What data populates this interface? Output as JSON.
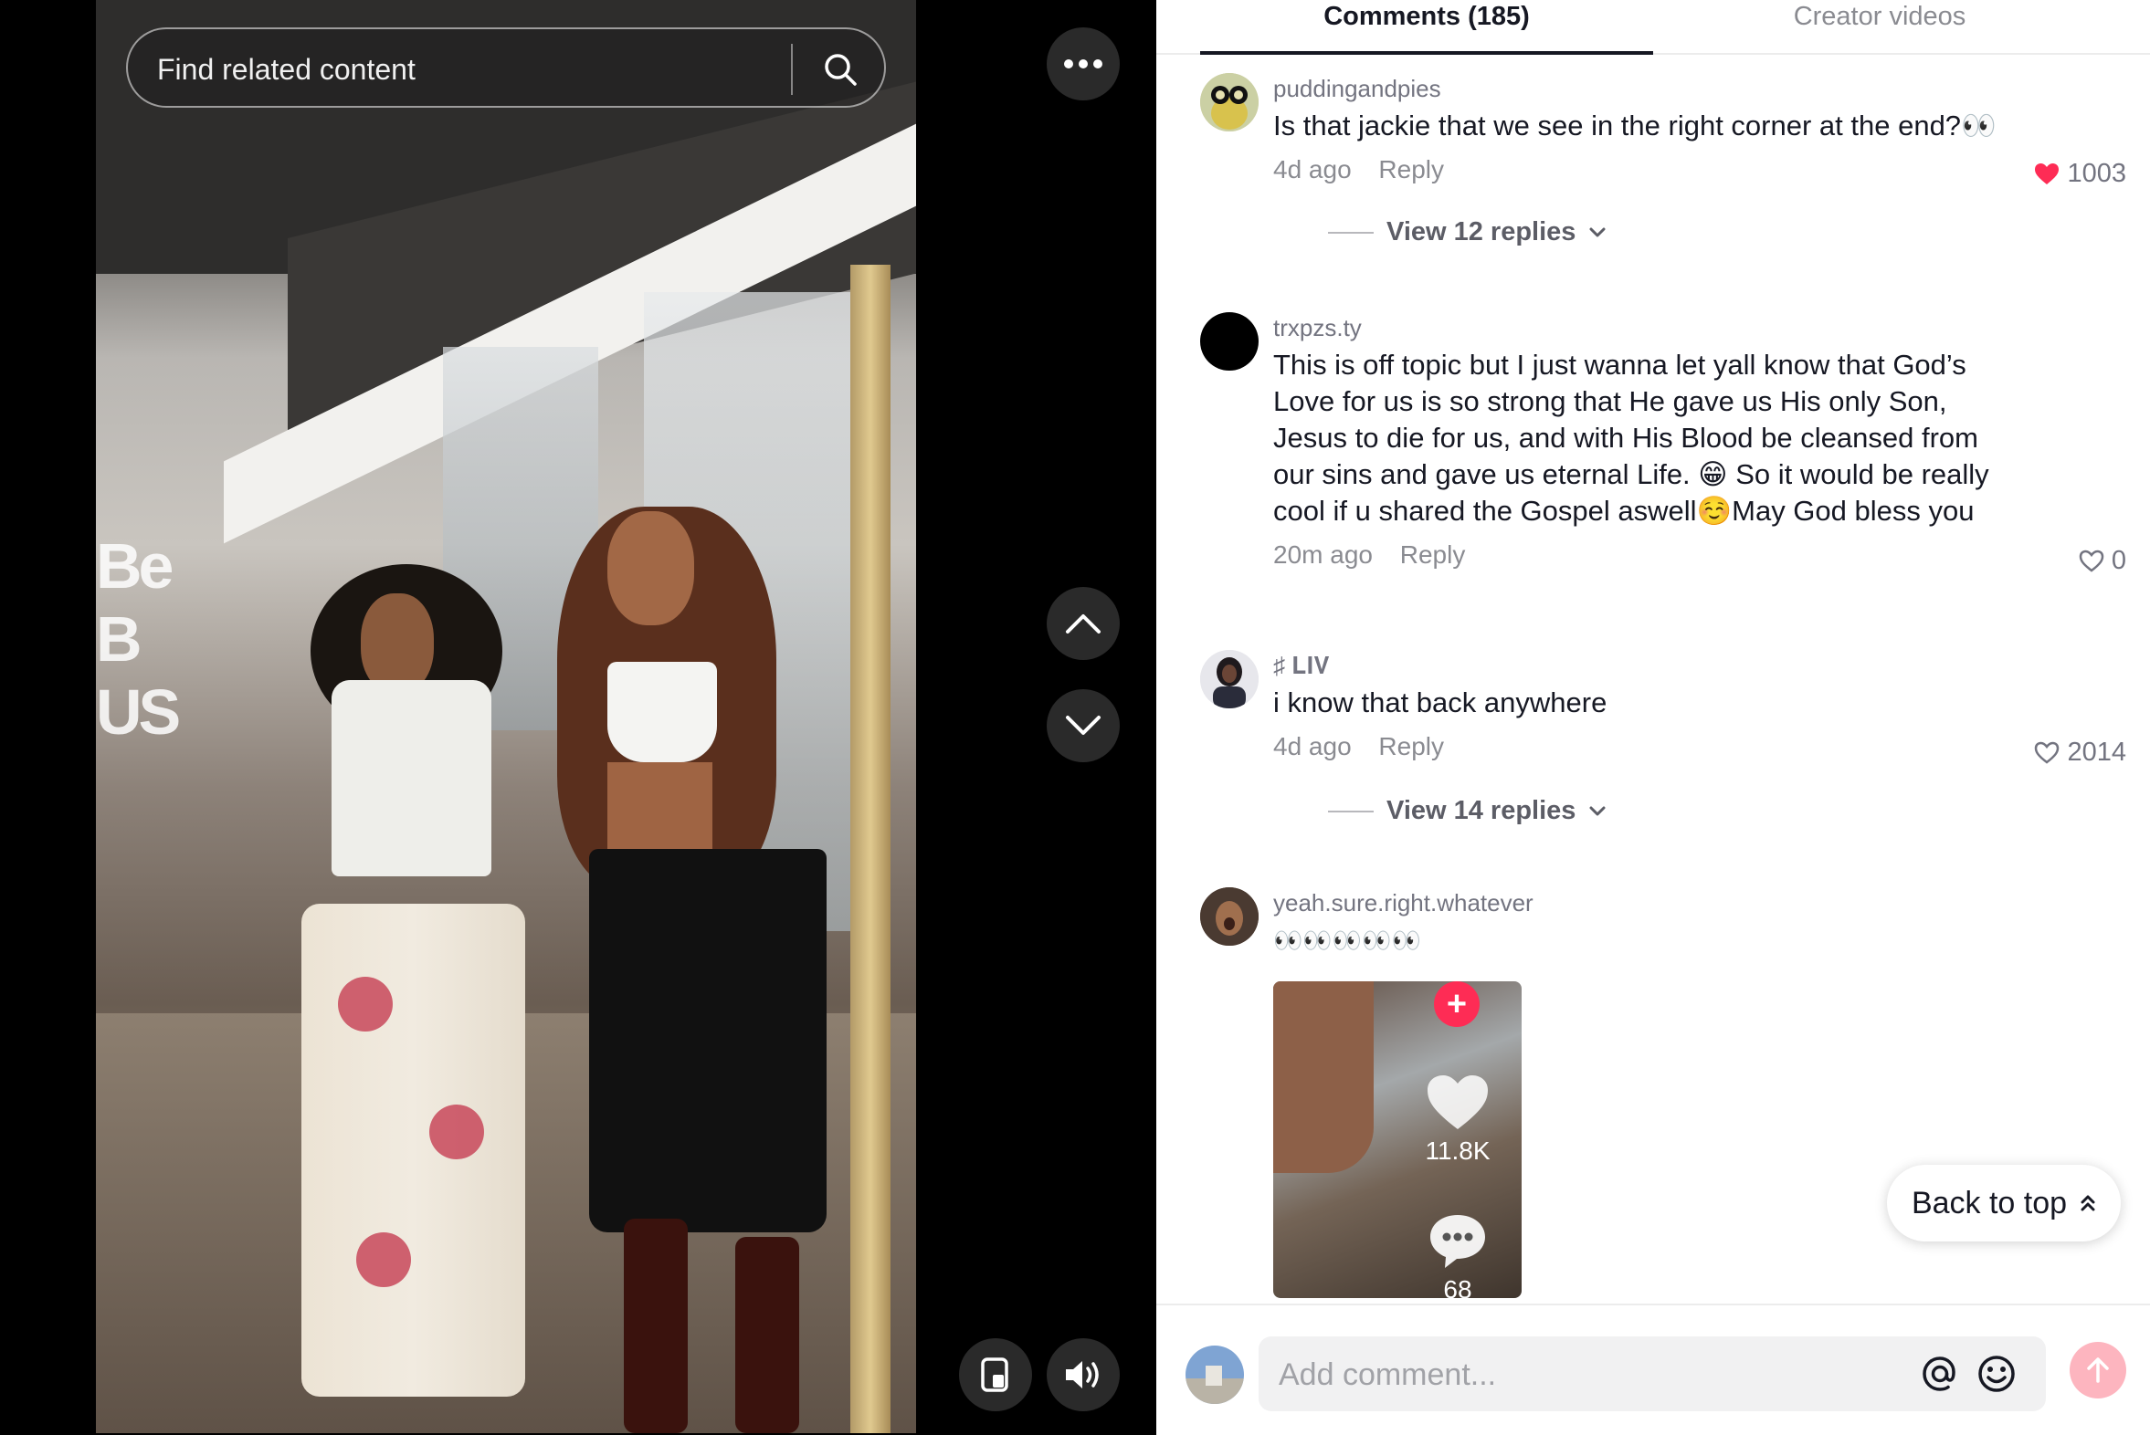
{
  "player": {
    "search": {
      "placeholder": "Find related content"
    },
    "wall_sign": "Be B US"
  },
  "tabs": [
    {
      "label": "Comments (185)",
      "active": true
    },
    {
      "label": "Creator videos",
      "active": false
    }
  ],
  "comments": [
    {
      "username": "puddingandpies",
      "text": "Is that jackie that we see in the right corner at the end?👀",
      "time": "4d ago",
      "reply_label": "Reply",
      "likes": "1003",
      "liked": true,
      "view_replies": "View 12 replies"
    },
    {
      "username": "trxpzs.ty",
      "text": "This is off topic but I just wanna let yall know that God’s Love for us is so strong that He gave us His only Son, Jesus to die for us, and with His Blood be cleansed from our sins and gave us eternal Life. 😁 So it would be really cool if u shared the Gospel aswell☺️May God bless you",
      "time": "20m ago",
      "reply_label": "Reply",
      "likes": "0",
      "liked": false
    },
    {
      "username": "♯ 𝐋𝐈𝐕",
      "text": "i know that back anywhere",
      "time": "4d ago",
      "reply_label": "Reply",
      "likes": "2014",
      "liked": false,
      "view_replies": "View 14 replies"
    },
    {
      "username": "yeah.sure.right.whatever",
      "text": "👀👀👀👀👀",
      "sticker": {
        "like_count": "11.8K",
        "comment_count": "68"
      }
    }
  ],
  "back_to_top": "Back to top",
  "compose": {
    "placeholder": "Add comment..."
  },
  "colors": {
    "like_red": "#fe2c55",
    "post_button": "#fdb5bf",
    "text": "#161823",
    "muted": "#8a8b91"
  }
}
